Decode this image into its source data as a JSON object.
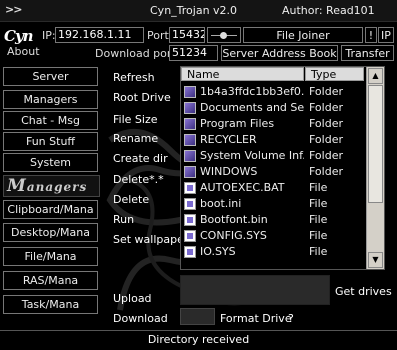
{
  "titlebar": {
    "chevron": ">>",
    "title": "Cyn_Trojan v2.0",
    "author": "Author: Read101"
  },
  "logo": {
    "text": "Cyn",
    "about": "About"
  },
  "connection": {
    "ip_label": "IP:",
    "ip_value": "192.168.1.11",
    "port_label": "Port:",
    "port_value": "15432",
    "download_port_label": "Download port:",
    "download_port_value": "51234"
  },
  "top_buttons": {
    "file_joiner": "File Joiner",
    "excl": "!",
    "ip": "IP",
    "server_address_book": "Server Address Book",
    "transfer": "Transfer"
  },
  "nav": {
    "items": [
      "Server",
      "Managers",
      "Chat - Msg",
      "Fun Stuff",
      "System"
    ],
    "watermark": "Managers",
    "managers": [
      "Clipboard/Mana",
      "Desktop/Mana",
      "File/Mana",
      "RAS/Mana",
      "Task/Mana"
    ]
  },
  "commands": {
    "refresh": "Refresh",
    "root_drive": "Root Drive",
    "file_size": "File Size",
    "rename": "Rename",
    "create_dir": "Create dir",
    "delete_all": "Delete*.*",
    "delete": "Delete",
    "run": "Run",
    "set_wallpaper": "Set wallpaper"
  },
  "file_list": {
    "columns": [
      "Name",
      "Type"
    ],
    "rows": [
      {
        "name": "1b4a3ffdc1bb3ef0...",
        "type": "Folder",
        "icon": "folder-icon"
      },
      {
        "name": "Documents and Se...",
        "type": "Folder",
        "icon": "folder-icon"
      },
      {
        "name": "Program Files",
        "type": "Folder",
        "icon": "folder-icon"
      },
      {
        "name": "RECYCLER",
        "type": "Folder",
        "icon": "folder-icon"
      },
      {
        "name": "System Volume Inf...",
        "type": "Folder",
        "icon": "folder-icon"
      },
      {
        "name": "WINDOWS",
        "type": "Folder",
        "icon": "folder-icon"
      },
      {
        "name": "AUTOEXEC.BAT",
        "type": "File",
        "icon": "file-icon"
      },
      {
        "name": "boot.ini",
        "type": "File",
        "icon": "file-icon"
      },
      {
        "name": "Bootfont.bin",
        "type": "File",
        "icon": "file-icon"
      },
      {
        "name": "CONFIG.SYS",
        "type": "File",
        "icon": "file-icon"
      },
      {
        "name": "IO.SYS",
        "type": "File",
        "icon": "file-icon"
      }
    ]
  },
  "bottom": {
    "upload": "Upload",
    "get_drives": "Get drives",
    "download": "Download",
    "format_drive": "Format Drive",
    "question": "?"
  },
  "status": "Directory received"
}
